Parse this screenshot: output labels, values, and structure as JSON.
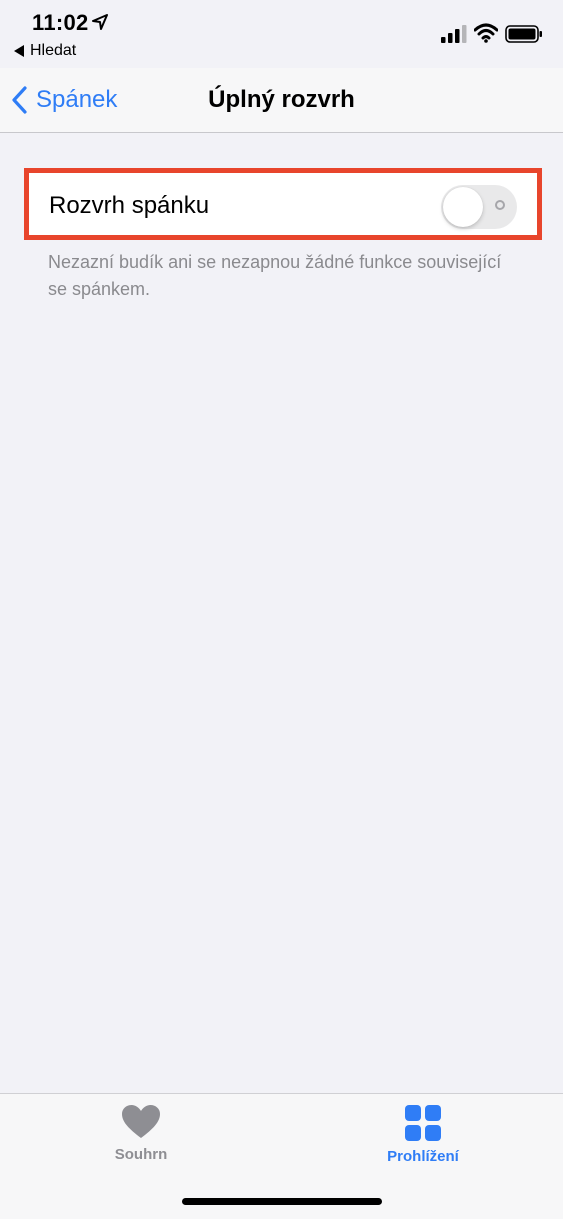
{
  "status_bar": {
    "time": "11:02",
    "back_app": "Hledat"
  },
  "nav": {
    "back_label": "Spánek",
    "title": "Úplný rozvrh"
  },
  "settings": {
    "sleep_schedule_label": "Rozvrh spánku",
    "sleep_schedule_enabled": false,
    "footnote": "Nezazní budík ani se nezapnou žádné funkce související se spánkem."
  },
  "tab_bar": {
    "tabs": [
      {
        "label": "Souhrn",
        "icon": "heart-icon",
        "active": false
      },
      {
        "label": "Prohlížení",
        "icon": "grid-icon",
        "active": true
      }
    ]
  },
  "colors": {
    "accent": "#2f7df6",
    "highlight_border": "#e8452c",
    "background": "#f2f2f7"
  }
}
